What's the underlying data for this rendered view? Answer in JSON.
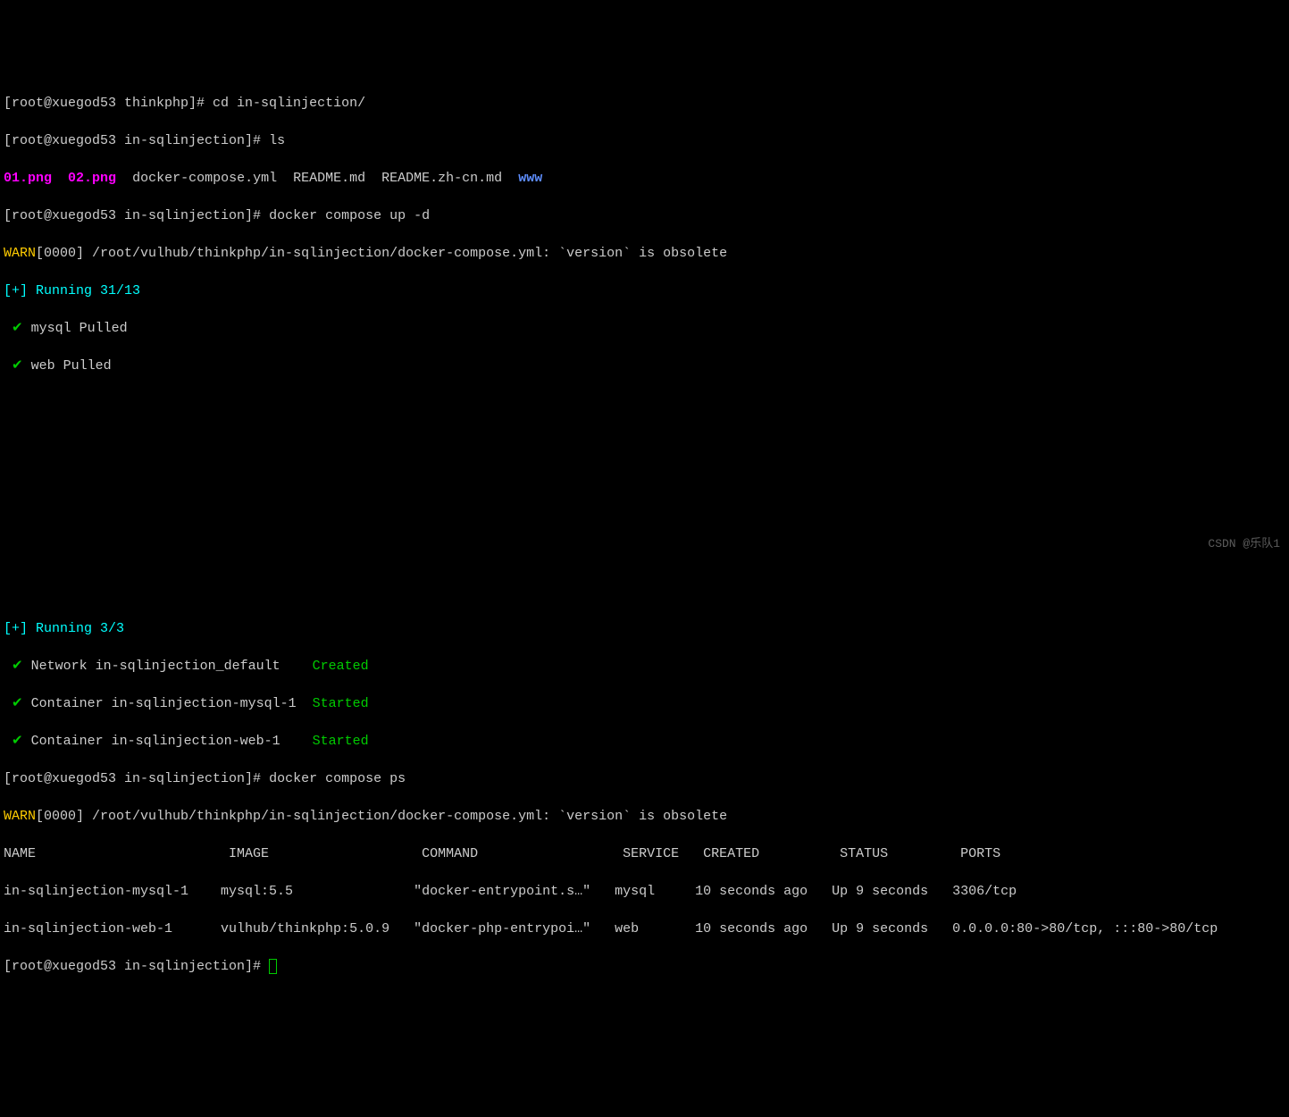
{
  "lines": {
    "l1_prompt": "[root@xuegod53 thinkphp]# ",
    "l1_cmd": "cd in-sqlinjection/",
    "l2_prompt": "[root@xuegod53 in-sqlinjection]# ",
    "l2_cmd": "ls",
    "l3_f1": "01.png",
    "l3_sp1": "  ",
    "l3_f2": "02.png",
    "l3_sp2": "  ",
    "l3_f3": "docker-compose.yml",
    "l3_sp3": "  ",
    "l3_f4": "README.md",
    "l3_sp4": "  ",
    "l3_f5": "README.zh-cn.md",
    "l3_sp5": "  ",
    "l3_f6": "www",
    "l4_prompt": "[root@xuegod53 in-sqlinjection]# ",
    "l4_cmd": "docker compose up -d",
    "l5_warn": "WARN",
    "l5_rest": "[0000] /root/vulhub/thinkphp/in-sqlinjection/docker-compose.yml: `version` is obsolete ",
    "l6_lbr": "[+]",
    "l6_rest": " Running 31/13",
    "l7_check": " ✔",
    "l7_rest": " mysql Pulled ",
    "l8_check": " ✔",
    "l8_rest": " web Pulled ",
    "l9_lbr": "[+]",
    "l9_rest": " Running 3/3",
    "l10_check": " ✔",
    "l10_name": " Network in-sqlinjection_default    ",
    "l10_status": "Created",
    "l11_check": " ✔",
    "l11_name": " Container in-sqlinjection-mysql-1  ",
    "l11_status": "Started",
    "l12_check": " ✔",
    "l12_name": " Container in-sqlinjection-web-1    ",
    "l12_status": "Started",
    "l13_prompt": "[root@xuegod53 in-sqlinjection]# ",
    "l13_cmd": "docker compose ps",
    "l14_warn": "WARN",
    "l14_rest": "[0000] /root/vulhub/thinkphp/in-sqlinjection/docker-compose.yml: `version` is obsolete ",
    "l15_header": "NAME                        IMAGE                   COMMAND                  SERVICE   CREATED          STATUS         PORTS",
    "l16_row": "in-sqlinjection-mysql-1    mysql:5.5               \"docker-entrypoint.s…\"   mysql     10 seconds ago   Up 9 seconds   3306/tcp",
    "l17_row": "in-sqlinjection-web-1      vulhub/thinkphp:5.0.9   \"docker-php-entrypoi…\"   web       10 seconds ago   Up 9 seconds   0.0.0.0:80->80/tcp, :::80->80/tcp",
    "l18_prompt": "[root@xuegod53 in-sqlinjection]# "
  },
  "watermark": "CSDN @乐队1"
}
